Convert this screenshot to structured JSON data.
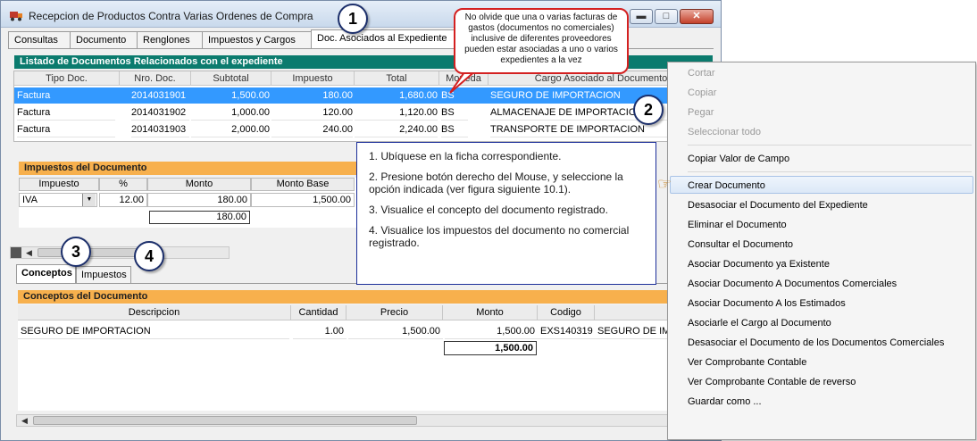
{
  "window": {
    "title": "Recepcion de Productos Contra Varias Ordenes de Compra",
    "min_glyph": "▬",
    "max_glyph": "□",
    "close_glyph": "✕"
  },
  "tabs": [
    "Consultas",
    "Documento",
    "Renglones",
    "Impuestos y Cargos",
    "Doc. Asociados al Expediente"
  ],
  "documents": {
    "title": "Listado de Documentos Relacionados con el expediente",
    "columns": [
      "Tipo Doc.",
      "Nro. Doc.",
      "Subtotal",
      "Impuesto",
      "Total",
      "Moneda",
      "Cargo Asociado al Documento"
    ],
    "rows": [
      {
        "tipo": "Factura",
        "nro": "2014031901",
        "subtotal": "1,500.00",
        "impuesto": "180.00",
        "total": "1,680.00",
        "moneda": "BS",
        "cargo": "SEGURO DE IMPORTACION"
      },
      {
        "tipo": "Factura",
        "nro": "2014031902",
        "subtotal": "1,000.00",
        "impuesto": "120.00",
        "total": "1,120.00",
        "moneda": "BS",
        "cargo": "ALMACENAJE DE IMPORTACION"
      },
      {
        "tipo": "Factura",
        "nro": "2014031903",
        "subtotal": "2,000.00",
        "impuesto": "240.00",
        "total": "2,240.00",
        "moneda": "BS",
        "cargo": "TRANSPORTE DE IMPORTACION"
      }
    ]
  },
  "taxes": {
    "title": "Impuestos del Documento",
    "columns": [
      "Impuesto",
      "%",
      "Monto",
      "Monto Base"
    ],
    "row": {
      "impuesto": "IVA",
      "pct": "12.00",
      "monto": "180.00",
      "base": "1,500.00"
    },
    "total": "180.00"
  },
  "lower_tabs": [
    "Conceptos",
    "Impuestos"
  ],
  "concepts": {
    "title": "Conceptos del Documento",
    "columns": [
      "Descripcion",
      "Cantidad",
      "Precio",
      "Monto",
      "Codigo"
    ],
    "row": {
      "descripcion": "SEGURO DE IMPORTACION",
      "cantidad": "1.00",
      "precio": "1,500.00",
      "monto": "1,500.00",
      "codigo": "EXS140319",
      "extra": "SEGURO DE IMP"
    },
    "total": "1,500.00"
  },
  "callouts": {
    "n1": "1",
    "n2": "2",
    "n3": "3",
    "n4": "4",
    "note": "No olvide que una o varias facturas de gastos (documentos no comerciales) inclusive de diferentes proveedores pueden estar asociadas a uno o varios expedientes a la vez"
  },
  "instructions": [
    "1. Ubíquese en la ficha correspondiente.",
    "2. Presione botón derecho del Mouse, y seleccione la opción indicada (ver figura siguiente 10.1).",
    "3. Visualice el concepto del documento registrado.",
    "4. Visualice los impuestos del documento no comercial registrado."
  ],
  "context_menu": {
    "items": [
      {
        "label": "Cortar",
        "enabled": false
      },
      {
        "label": "Copiar",
        "enabled": false
      },
      {
        "label": "Pegar",
        "enabled": false
      },
      {
        "label": "Seleccionar todo",
        "enabled": false
      },
      {
        "label": "Copiar Valor de Campo",
        "enabled": true
      },
      {
        "label": "Crear Documento",
        "enabled": true,
        "highlighted": true
      },
      {
        "label": "Desasociar el Documento del Expediente",
        "enabled": true
      },
      {
        "label": "Eliminar el Documento",
        "enabled": true
      },
      {
        "label": "Consultar el Documento",
        "enabled": true
      },
      {
        "label": "Asociar Documento ya Existente",
        "enabled": true
      },
      {
        "label": "Asociar Documento A Documentos Comerciales",
        "enabled": true
      },
      {
        "label": "Asociar Documento A los Estimados",
        "enabled": true
      },
      {
        "label": "Asociarle el Cargo al Documento",
        "enabled": true
      },
      {
        "label": "Desasociar el Documento de los Documentos Comerciales",
        "enabled": true
      },
      {
        "label": "Ver Comprobante Contable",
        "enabled": true
      },
      {
        "label": "Ver Comprobante Contable de reverso",
        "enabled": true
      },
      {
        "label": "Guardar como ...",
        "enabled": true
      }
    ],
    "pointer_glyph": "☞"
  },
  "colors": {
    "doc_header": "#0b7b6e",
    "section_header": "#f7b04d",
    "selection": "#3399ff",
    "note_border": "#d42121",
    "callout_border": "#1c2f6b"
  }
}
